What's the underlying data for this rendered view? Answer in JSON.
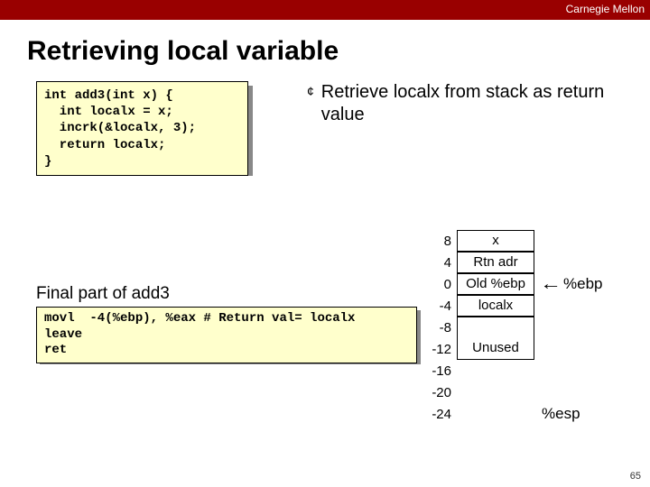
{
  "brand": "Carnegie Mellon",
  "title": "Retrieving local variable",
  "code1": "int add3(int x) {\n  int localx = x;\n  incrk(&localx, 3);\n  return localx;\n}",
  "bullet": "Retrieve localx from stack as return value",
  "subhead": "Final part of add3",
  "code2": "movl  -4(%ebp), %eax # Return val= localx\nleave\nret",
  "stack": {
    "rows": [
      {
        "offset": "8",
        "label": "x",
        "border": true
      },
      {
        "offset": "4",
        "label": "Rtn adr",
        "border": true
      },
      {
        "offset": "0",
        "label": "Old %ebp",
        "border": true,
        "ptr": "%ebp"
      },
      {
        "offset": "-4",
        "label": "localx",
        "border": true
      },
      {
        "offset": "-8",
        "label": "",
        "border": true
      },
      {
        "offset": "-12",
        "label": "Unused",
        "border": true
      },
      {
        "offset": "-16",
        "label": "",
        "border": false
      },
      {
        "offset": "-20",
        "label": "",
        "border": false
      },
      {
        "offset": "-24",
        "label": "",
        "border": false,
        "ptr": "%esp"
      }
    ]
  },
  "pagenum": "65"
}
